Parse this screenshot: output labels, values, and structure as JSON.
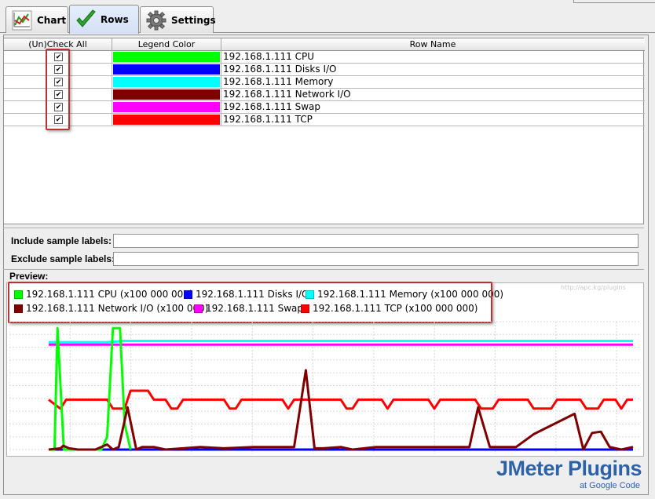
{
  "tabs": [
    {
      "label": "Chart",
      "icon": "line-chart-icon"
    },
    {
      "label": "Rows",
      "icon": "checkmark-icon"
    },
    {
      "label": "Settings",
      "icon": "gear-icon"
    }
  ],
  "table": {
    "headers": [
      "(Un)Check All",
      "Legend Color",
      "Row Name"
    ],
    "rows": [
      {
        "checked": true,
        "color": "#00ff00",
        "name": "192.168.1.111 CPU"
      },
      {
        "checked": true,
        "color": "#0000ff",
        "name": "192.168.1.111 Disks I/O"
      },
      {
        "checked": true,
        "color": "#00ffff",
        "name": "192.168.1.111 Memory"
      },
      {
        "checked": true,
        "color": "#800000",
        "name": "192.168.1.111 Network I/O"
      },
      {
        "checked": true,
        "color": "#ff00ff",
        "name": "192.168.1.111 Swap"
      },
      {
        "checked": true,
        "color": "#ff0000",
        "name": "192.168.1.111 TCP"
      }
    ]
  },
  "fields": {
    "include_label": "Include sample labels:",
    "exclude_label": "Exclude sample labels:",
    "include_value": "",
    "exclude_value": ""
  },
  "preview": {
    "label": "Preview:",
    "watermark": "http://apc.kg/plugins",
    "legend": [
      {
        "label": "192.168.1.111 CPU (x100 000 000)",
        "color": "#00ff00"
      },
      {
        "label": "192.168.1.111 Disks I/O",
        "color": "#0000ff"
      },
      {
        "label": "192.168.1.111 Memory (x100 000 000)",
        "color": "#00ffff"
      },
      {
        "label": "192.168.1.111 Network I/O (x100 000)",
        "color": "#800000"
      },
      {
        "label": "192.168.1.111 Swap",
        "color": "#ff00ff"
      },
      {
        "label": "192.168.1.111 TCP (x100 000 000)",
        "color": "#ff0000"
      }
    ]
  },
  "chart_data": {
    "type": "line",
    "title": "",
    "xlabel": "",
    "ylabel": "",
    "grid": true,
    "legend_position": "top-left",
    "ylim": [
      0,
      10
    ],
    "x": [
      0,
      1,
      2,
      3,
      4,
      5,
      6,
      7,
      8,
      9,
      10,
      11,
      12,
      13,
      14,
      15,
      16,
      17,
      18,
      19,
      20,
      21,
      22,
      23,
      24,
      25,
      26,
      27,
      28,
      29,
      30,
      31,
      32,
      33,
      34,
      35,
      36,
      37,
      38,
      39,
      40,
      41,
      42,
      43,
      44,
      45,
      46,
      47,
      48,
      49,
      50,
      51,
      52,
      53,
      54,
      55,
      56,
      57,
      58,
      59,
      60,
      61,
      62,
      63,
      64,
      65,
      66,
      67,
      68,
      69,
      70,
      71,
      72,
      73,
      74,
      75,
      76,
      77,
      78,
      79,
      80,
      81,
      82,
      83,
      84,
      85,
      86,
      87,
      88,
      89,
      90,
      91,
      92,
      93,
      94,
      95,
      96,
      97,
      98,
      99,
      100
    ],
    "series": [
      {
        "name": "192.168.1.111 CPU (x100 000 000)",
        "color": "#00ff00",
        "values": [
          0,
          0,
          0,
          0,
          0,
          0,
          0,
          0,
          0,
          0,
          0,
          0,
          0,
          0,
          0,
          0,
          0,
          0,
          0,
          0,
          0,
          0,
          0,
          0,
          0,
          0,
          0,
          0,
          0,
          0,
          0,
          0,
          0,
          0,
          0,
          0,
          0,
          0,
          0,
          0,
          0,
          0,
          0,
          0,
          0,
          0,
          0,
          0,
          0,
          0,
          0,
          0,
          0,
          0,
          0,
          0,
          0,
          0,
          0,
          0,
          0,
          0,
          0,
          0,
          0,
          0,
          0,
          0,
          0,
          0,
          0,
          0,
          0,
          0,
          0,
          0,
          0,
          0,
          0,
          0,
          0,
          0,
          0,
          0,
          0,
          0,
          0,
          0,
          0,
          0,
          0,
          0,
          0,
          0,
          0,
          0,
          0,
          0,
          0,
          0,
          0
        ],
        "points": [
          [
            0,
            0
          ],
          [
            1,
            0
          ],
          [
            1.5,
            9.5
          ],
          [
            2.6,
            0
          ],
          [
            9,
            0
          ],
          [
            10,
            1
          ],
          [
            11,
            9.5
          ],
          [
            12.2,
            9.5
          ],
          [
            13,
            2
          ],
          [
            14,
            0
          ]
        ]
      },
      {
        "name": "192.168.1.111 Disks I/O",
        "color": "#0000ff",
        "points": [
          [
            0,
            0
          ],
          [
            100,
            0
          ]
        ]
      },
      {
        "name": "192.168.1.111 Memory (x100 000 000)",
        "color": "#00ffff",
        "points": [
          [
            0,
            8.4
          ],
          [
            10,
            8.4
          ],
          [
            13,
            8.5
          ],
          [
            100,
            8.5
          ]
        ]
      },
      {
        "name": "192.168.1.111 Network I/O (x100 000)",
        "color": "#800000",
        "points": [
          [
            0,
            0
          ],
          [
            2,
            0.1
          ],
          [
            2.5,
            0.3
          ],
          [
            3.5,
            0.1
          ],
          [
            5,
            0
          ],
          [
            8,
            0
          ],
          [
            10,
            0.4
          ],
          [
            11,
            0
          ],
          [
            12,
            0.2
          ],
          [
            13.5,
            3.3
          ],
          [
            15,
            0
          ],
          [
            16,
            0.2
          ],
          [
            18,
            0.2
          ],
          [
            20,
            0
          ],
          [
            26,
            0.2
          ],
          [
            30,
            0.1
          ],
          [
            35,
            0.2
          ],
          [
            40,
            0.2
          ],
          [
            42,
            0.2
          ],
          [
            44,
            6.2
          ],
          [
            45.5,
            0.1
          ],
          [
            47,
            0.1
          ],
          [
            50,
            0.2
          ],
          [
            52,
            0
          ],
          [
            56,
            0.2
          ],
          [
            60,
            0.2
          ],
          [
            63,
            0.2
          ],
          [
            66,
            0.2
          ],
          [
            70,
            0.2
          ],
          [
            72,
            0.2
          ],
          [
            73.5,
            3.3
          ],
          [
            75.5,
            0.2
          ],
          [
            77,
            0.2
          ],
          [
            80,
            0.2
          ],
          [
            83,
            1.2
          ],
          [
            90,
            2.8
          ],
          [
            91.5,
            0
          ],
          [
            93,
            1.3
          ],
          [
            94.5,
            1.4
          ],
          [
            96,
            0.2
          ],
          [
            98,
            0
          ],
          [
            100,
            0.2
          ]
        ]
      },
      {
        "name": "192.168.1.111 Swap",
        "color": "#ff00ff",
        "points": [
          [
            0,
            8.2
          ],
          [
            100,
            8.2
          ]
        ]
      },
      {
        "name": "192.168.1.111 TCP (x100 000 000)",
        "color": "#ff0000",
        "points": [
          [
            0,
            3.9
          ],
          [
            2,
            3.2
          ],
          [
            3,
            3.9
          ],
          [
            9,
            3.9
          ],
          [
            10,
            3.9
          ],
          [
            11,
            3.2
          ],
          [
            13,
            3.2
          ],
          [
            14,
            4.6
          ],
          [
            17,
            4.6
          ],
          [
            18,
            3.9
          ],
          [
            20,
            3.9
          ],
          [
            21,
            3.2
          ],
          [
            22,
            3.2
          ],
          [
            23,
            3.9
          ],
          [
            30,
            3.9
          ],
          [
            31,
            3.2
          ],
          [
            32,
            3.2
          ],
          [
            33,
            3.9
          ],
          [
            40,
            3.9
          ],
          [
            41,
            3.2
          ],
          [
            42,
            3.9
          ],
          [
            50,
            3.9
          ],
          [
            51,
            3.2
          ],
          [
            52,
            3.2
          ],
          [
            53,
            3.9
          ],
          [
            57,
            3.9
          ],
          [
            58,
            3.2
          ],
          [
            59,
            3.9
          ],
          [
            65,
            3.9
          ],
          [
            66,
            3.2
          ],
          [
            67,
            3.9
          ],
          [
            73,
            3.9
          ],
          [
            74,
            3.2
          ],
          [
            76,
            3.2
          ],
          [
            77,
            3.9
          ],
          [
            82,
            3.9
          ],
          [
            83,
            3.2
          ],
          [
            86,
            3.2
          ],
          [
            87,
            3.9
          ],
          [
            91,
            3.9
          ],
          [
            92,
            3.2
          ],
          [
            94,
            3.2
          ],
          [
            95,
            3.9
          ],
          [
            97,
            3.9
          ],
          [
            98,
            3.2
          ],
          [
            99,
            3.9
          ],
          [
            100,
            3.9
          ]
        ]
      }
    ]
  },
  "branding": {
    "title": "JMeter Plugins",
    "subtitle": "at Google Code"
  }
}
